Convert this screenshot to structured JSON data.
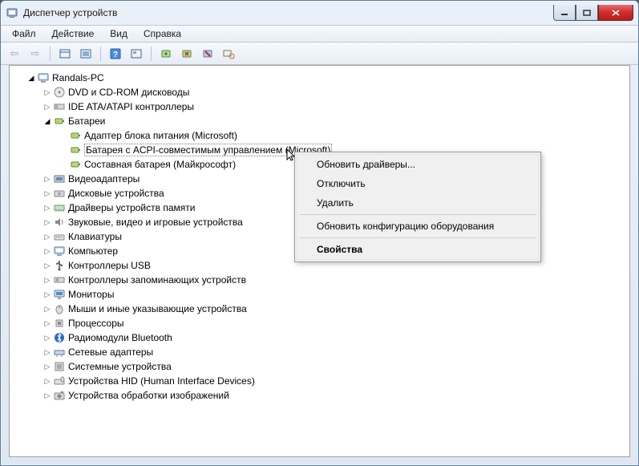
{
  "window": {
    "title": "Диспетчер устройств"
  },
  "menu": {
    "file": "Файл",
    "action": "Действие",
    "view": "Вид",
    "help": "Справка"
  },
  "tree": {
    "root": "Randals-PC",
    "items": [
      "DVD и CD-ROM дисководы",
      "IDE ATA/ATAPI контроллеры",
      "Батареи",
      "Видеоадаптеры",
      "Дисковые устройства",
      "Драйверы устройств памяти",
      "Звуковые, видео и игровые устройства",
      "Клавиатуры",
      "Компьютер",
      "Контроллеры USB",
      "Контроллеры запоминающих устройств",
      "Мониторы",
      "Мыши и иные указывающие устройства",
      "Процессоры",
      "Радиомодули Bluetooth",
      "Сетевые адаптеры",
      "Системные устройства",
      "Устройства HID (Human Interface Devices)",
      "Устройства обработки изображений"
    ],
    "batteries": {
      "items": [
        "Адаптер блока питания (Microsoft)",
        "Батарея с ACPI-совместимым управлением (Microsoft)",
        "Составная батарея (Майкрософт)"
      ]
    }
  },
  "context": {
    "update": "Обновить драйверы...",
    "disable": "Отключить",
    "remove": "Удалить",
    "scan": "Обновить конфигурацию оборудования",
    "properties": "Свойства"
  }
}
